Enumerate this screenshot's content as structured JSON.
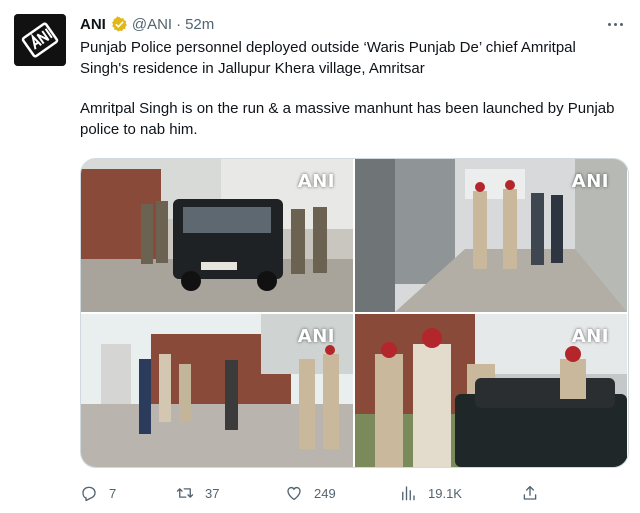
{
  "tweet": {
    "author_name": "ANI",
    "handle": "@ANI",
    "separator": "·",
    "time": "52m",
    "paragraphs": [
      "Punjab Police personnel deployed outside ‘Waris Punjab De’ chief Amritpal Singh's residence in Jallupur Khera village, Amritsar",
      "Amritpal Singh is on the run & a massive manhunt has been launched by Punjab police to nab him."
    ],
    "media": [
      {
        "watermark": "ANI",
        "icon": "photo-police-vehicle"
      },
      {
        "watermark": "ANI",
        "icon": "photo-police-lane"
      },
      {
        "watermark": "ANI",
        "icon": "photo-street-group"
      },
      {
        "watermark": "ANI",
        "icon": "photo-officer-vehicle"
      }
    ],
    "actions": {
      "reply_count": "7",
      "retweet_count": "37",
      "like_count": "249",
      "view_count": "19.1K"
    }
  },
  "colors": {
    "text": "#0f1419",
    "muted": "#536471",
    "border": "#cfd9de",
    "verified_gold": "#e2b719"
  }
}
